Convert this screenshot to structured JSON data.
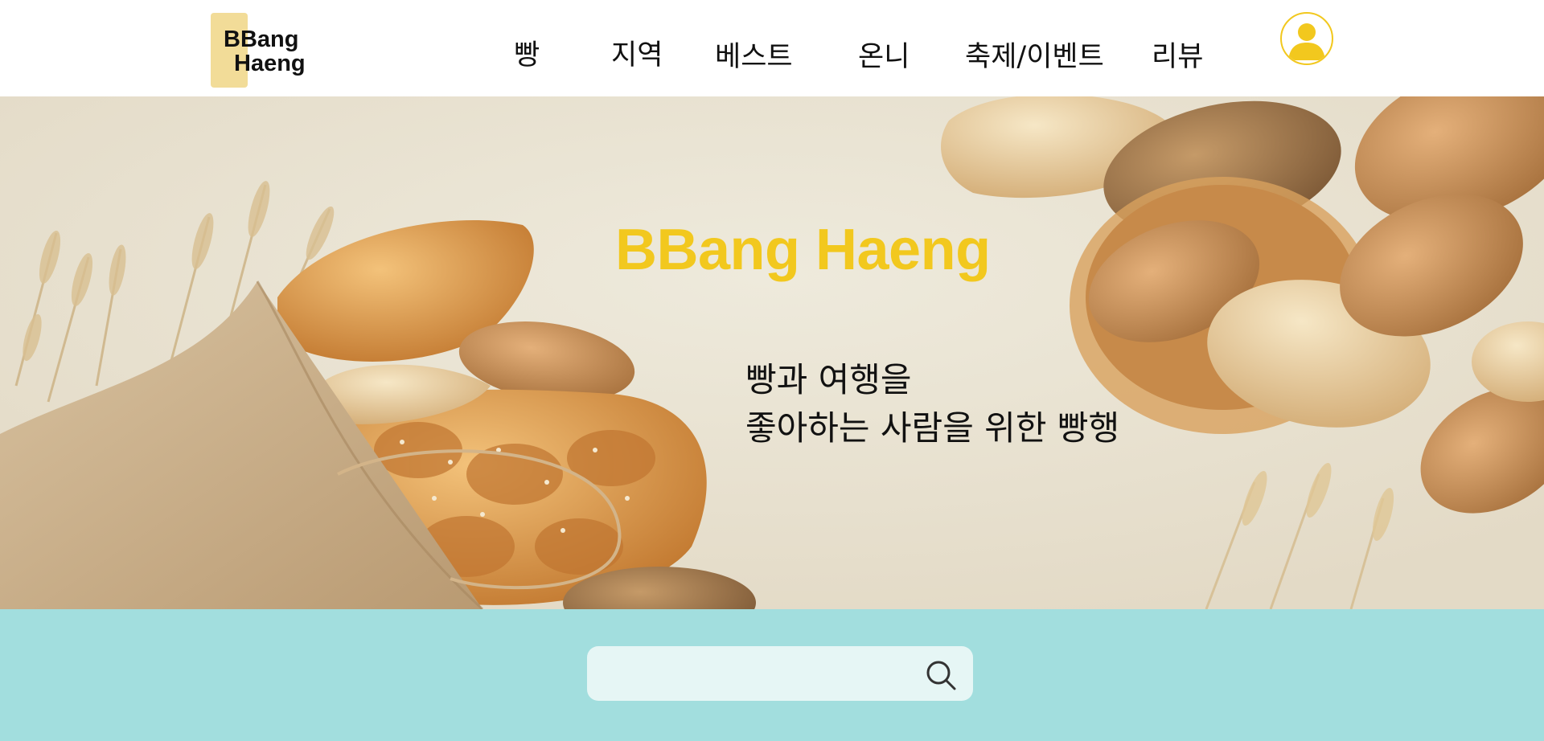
{
  "brand": {
    "logo_line1": "BBang",
    "logo_line2": "Haeng",
    "logo_color": "#f2dc98"
  },
  "nav": {
    "items": [
      {
        "label": "빵"
      },
      {
        "label": "지역"
      },
      {
        "label": "베스트"
      },
      {
        "label": "온니"
      },
      {
        "label": "축제/이벤트"
      },
      {
        "label": "리뷰"
      }
    ]
  },
  "user": {
    "icon": "user-avatar-icon",
    "accent": "#f2c81e"
  },
  "hero": {
    "title": "BBang Haeng",
    "subtitle_line1": "빵과 여행을",
    "subtitle_line2": "좋아하는 사람을 위한 빵행",
    "title_color": "#f2c81e"
  },
  "search": {
    "placeholder": "",
    "value": "",
    "icon": "search-icon",
    "band_color": "#a2dede"
  }
}
